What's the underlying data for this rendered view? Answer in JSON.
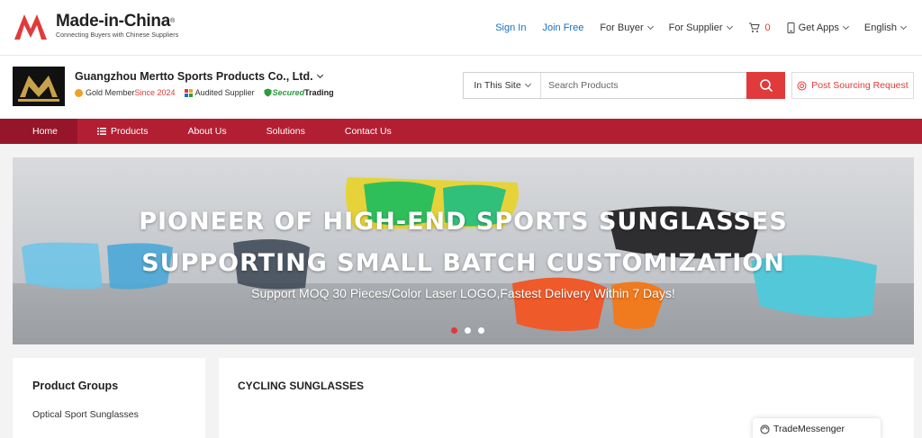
{
  "header": {
    "brand_title": "Made-in-China",
    "brand_reg": "®",
    "brand_tagline": "Connecting Buyers with Chinese Suppliers",
    "nav": {
      "sign_in": "Sign In",
      "join_free": "Join Free",
      "for_buyer": "For Buyer",
      "for_supplier": "For Supplier",
      "cart_count": "0",
      "get_apps": "Get Apps",
      "language": "English"
    }
  },
  "company": {
    "name": "Guangzhou Mertto Sports Products Co., Ltd.",
    "gold_member": "Gold Member",
    "since": "Since 2024",
    "audited": "Audited Supplier",
    "secured_prefix": "Secured",
    "secured_suffix": "Trading"
  },
  "search": {
    "scope": "In This Site",
    "placeholder": "Search Products"
  },
  "post_sourcing": "Post Sourcing Request",
  "mainnav": {
    "home": "Home",
    "products": "Products",
    "about": "About Us",
    "solutions": "Solutions",
    "contact": "Contact Us"
  },
  "banner": {
    "line1": "PIONEER OF HIGH-END SPORTS SUNGLASSES",
    "line2": "SUPPORTING SMALL BATCH CUSTOMIZATION",
    "subtitle": "Support MOQ 30 Pieces/Color Laser LOGO,Fastest Delivery Within 7 Days!",
    "active_slide": 1,
    "slide_count": 3
  },
  "groups": {
    "title": "Product Groups",
    "items": [
      "Optical Sport Sunglasses"
    ]
  },
  "section_title": "CYCLING SUNGLASSES",
  "trade_messenger": "TradeMessenger",
  "colors": {
    "brand_red": "#e03a3a",
    "nav_red": "#b31f32",
    "nav_active": "#97152a",
    "link_blue": "#1b6fc2",
    "secured_green": "#2e9b3e",
    "gold": "#f0a122"
  }
}
